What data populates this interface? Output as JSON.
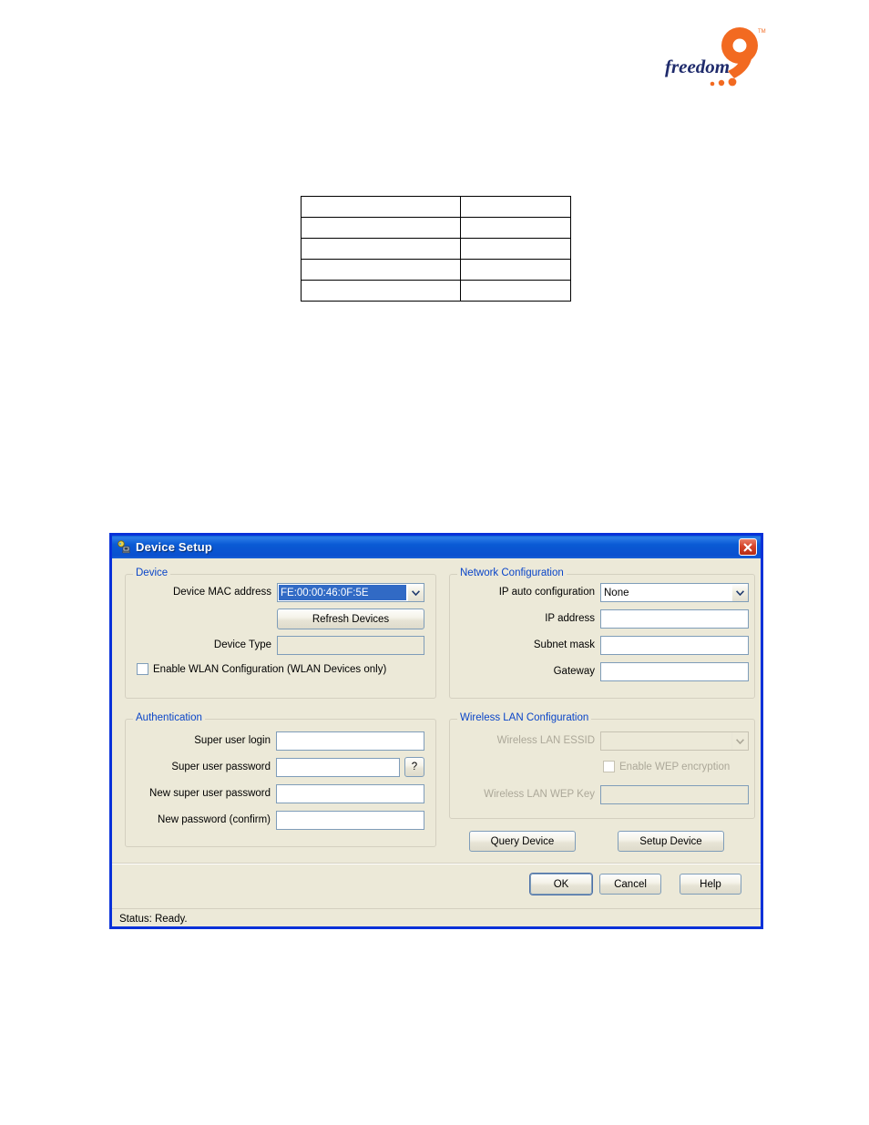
{
  "page": {
    "background": "#ffffff"
  },
  "logo": {
    "name": "freedom9-logo",
    "wordmark": "freedom",
    "numeral": "9",
    "trademark": "TM",
    "text_color": "#1f2b6c",
    "accent_color": "#f26a21"
  },
  "table": {
    "name": "empty-data-table",
    "rows": [
      [
        "",
        ""
      ],
      [
        "",
        ""
      ],
      [
        "",
        ""
      ],
      [
        "",
        ""
      ],
      [
        "",
        ""
      ]
    ]
  },
  "dialog": {
    "title": "Device Setup",
    "title_icon": "network-device-icon",
    "close_icon": "close-icon",
    "accent_color": "#0831d9",
    "face_color": "#ece9d8",
    "groups": {
      "device": {
        "legend": "Device",
        "mac_label": "Device MAC address",
        "mac_value": "FE:00:00:46:0F:5E",
        "refresh_label": "Refresh Devices",
        "device_type_label": "Device Type",
        "device_type_value": "",
        "wlan_checkbox_label": "Enable WLAN Configuration (WLAN Devices only)",
        "wlan_checked": false
      },
      "network": {
        "legend": "Network Configuration",
        "ip_auto_label": "IP auto configuration",
        "ip_auto_value": "None",
        "ip_address_label": "IP address",
        "ip_address_value": "",
        "subnet_label": "Subnet mask",
        "subnet_value": "",
        "gateway_label": "Gateway",
        "gateway_value": ""
      },
      "authentication": {
        "legend": "Authentication",
        "login_label": "Super user login",
        "login_value": "",
        "password_label": "Super user password",
        "password_value": "",
        "help_button_label": "?",
        "new_password_label": "New super user password",
        "new_password_value": "",
        "confirm_label": "New password (confirm)",
        "confirm_value": ""
      },
      "wireless": {
        "legend": "Wireless LAN Configuration",
        "essid_label": "Wireless LAN ESSID",
        "essid_value": "",
        "wep_checkbox_label": "Enable WEP encryption",
        "wep_checked": false,
        "wep_key_label": "Wireless LAN WEP Key",
        "wep_key_value": ""
      }
    },
    "buttons": {
      "query": "Query Device",
      "setup": "Setup Device",
      "ok": "OK",
      "cancel": "Cancel",
      "help": "Help"
    },
    "status": "Status: Ready."
  }
}
